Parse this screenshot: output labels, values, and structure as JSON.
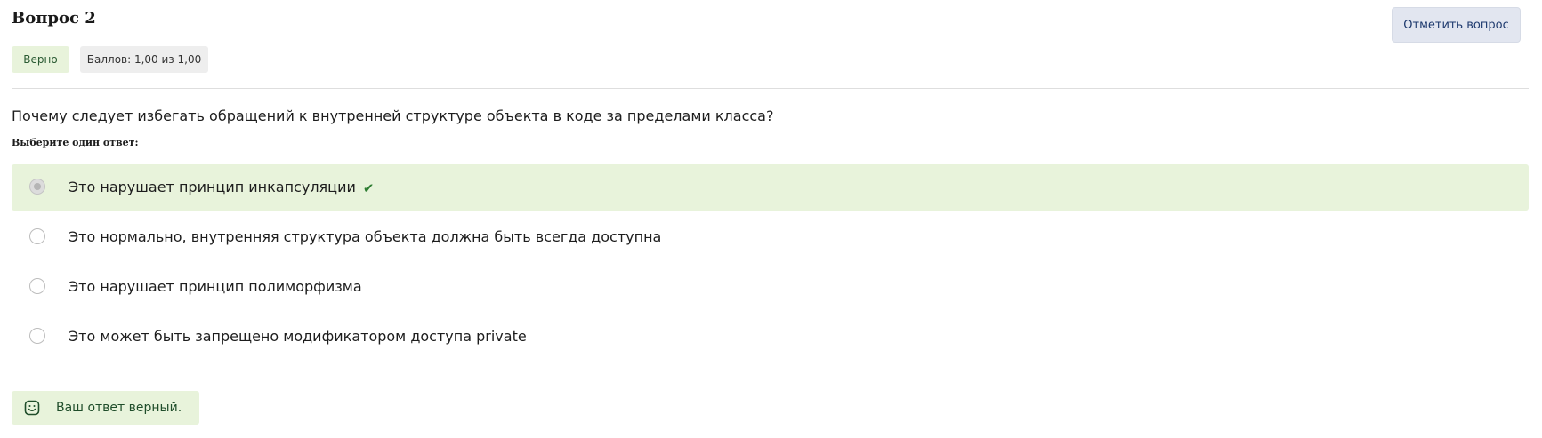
{
  "question": {
    "title": "Вопрос 2",
    "flag_button": "Отметить вопрос",
    "status_badge": "Верно",
    "score_badge": "Баллов: 1,00 из 1,00",
    "text": "Почему следует избегать обращений к внутренней структуре объекта в коде за пределами класса?",
    "prompt": "Выберите один ответ:"
  },
  "answers": [
    {
      "label": "Это нарушает принцип инкапсуляции",
      "selected": true,
      "correct": true
    },
    {
      "label": "Это нормально, внутренняя структура объекта должна быть всегда доступна",
      "selected": false
    },
    {
      "label": "Это нарушает принцип полиморфизма",
      "selected": false
    },
    {
      "label": "Это может быть запрещено модификатором доступа private",
      "selected": false
    }
  ],
  "feedback": {
    "text": "Ваш ответ верный.",
    "icon": "smile-icon"
  },
  "colors": {
    "correct_bg": "#e8f3db",
    "check": "#2e7d32",
    "flag_bg": "#e2e6f0"
  }
}
